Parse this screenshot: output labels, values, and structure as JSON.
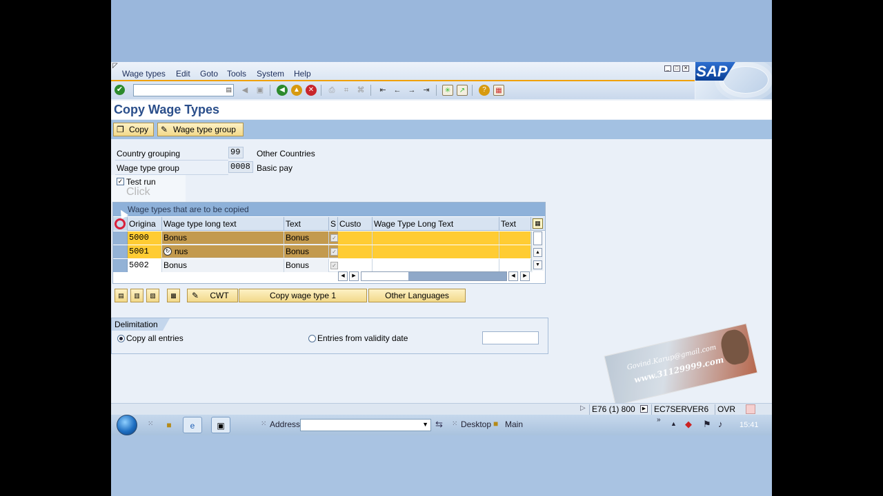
{
  "menu": [
    "Wage types",
    "Edit",
    "Goto",
    "Tools",
    "System",
    "Help"
  ],
  "logo_text": "SAP",
  "title": "Copy Wage Types",
  "app_toolbar": {
    "copy": "Copy",
    "wage_type_group": "Wage type group"
  },
  "fields": {
    "country_grouping_label": "Country grouping",
    "country_grouping_value": "99",
    "country_grouping_text": "Other Countries",
    "wage_type_group_label": "Wage type group",
    "wage_type_group_value": "0008",
    "wage_type_group_text": "Basic pay",
    "test_run_label": "Test run"
  },
  "annotation_click": "Click",
  "table": {
    "title": "Wage types that are to be copied",
    "headers": [
      "Origina",
      "Wage type long text",
      "Text",
      "S",
      "Custo",
      "Wage Type Long Text",
      "Text"
    ],
    "rows": [
      {
        "wt": "5000",
        "long": "Bonus",
        "text": "Bonus"
      },
      {
        "wt": "5001",
        "long": "nus",
        "text": "Bonus"
      },
      {
        "wt": "5002",
        "long": "Bonus",
        "text": "Bonus"
      }
    ]
  },
  "buttons": {
    "cwt": "CWT",
    "copy_wt": "Copy wage type 1",
    "other_lang": "Other Languages"
  },
  "delimitation": {
    "title": "Delimitation",
    "copy_all": "Copy all entries",
    "from_validity": "Entries from validity date"
  },
  "status": {
    "session": "E76 (1) 800",
    "server": "EC7SERVER6",
    "mode": "OVR"
  },
  "taskbar": {
    "address": "Address",
    "desktop": "Desktop",
    "main": "Main",
    "time": "15:41"
  },
  "watermark": {
    "line1": "Govind.Karup@gmail.com",
    "line2": "www.31129999.com"
  },
  "colors": {
    "accent": "#f0a000",
    "selected_row": "#c39a4e",
    "input_cell": "#ffcc33",
    "title": "#2a4e8a"
  }
}
